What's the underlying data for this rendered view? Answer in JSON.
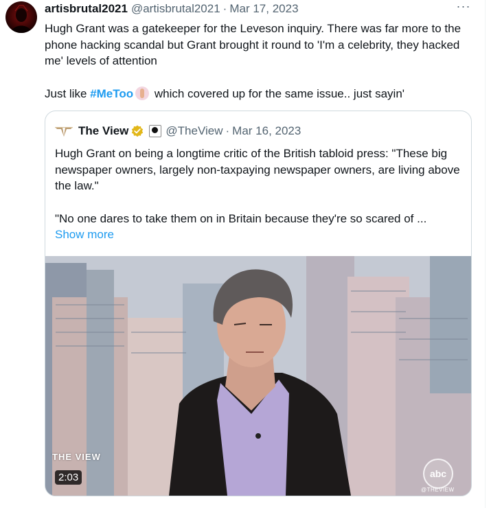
{
  "tweet": {
    "author_name": "artisbrutal2021",
    "author_handle": "@artisbrutal2021",
    "separator": "·",
    "date": "Mar 17, 2023",
    "more_label": "···",
    "text_line1": "Hugh Grant was a gatekeeper for the Leveson inquiry.  There was far more to the phone hacking scandal but Grant brought it round to 'I'm a celebrity, they hacked me' levels of attention",
    "text_p2_before": "Just like ",
    "hashtag": "#MeToo",
    "text_p2_after": " which covered up for the same issue.. just sayin'"
  },
  "quoted": {
    "name": "The View",
    "handle": "@TheView",
    "separator": "·",
    "date": "Mar 16, 2023",
    "para1": "Hugh Grant on being a longtime critic of the British tabloid press: \"These big newspaper owners, largely non-taxpaying newspaper owners, are living above the law.\"",
    "para2": "\"No one dares to take them on in Britain because they're so scared of ...",
    "show_more": "Show more",
    "video": {
      "duration": "2:03",
      "show_logo": "THE VIEW",
      "network_bug": "abc",
      "watermark": "@THEVIEW"
    }
  },
  "colors": {
    "link": "#1d9bf0",
    "muted": "#536471",
    "verified_gold": "#e2b719",
    "border": "#cfd9de"
  }
}
